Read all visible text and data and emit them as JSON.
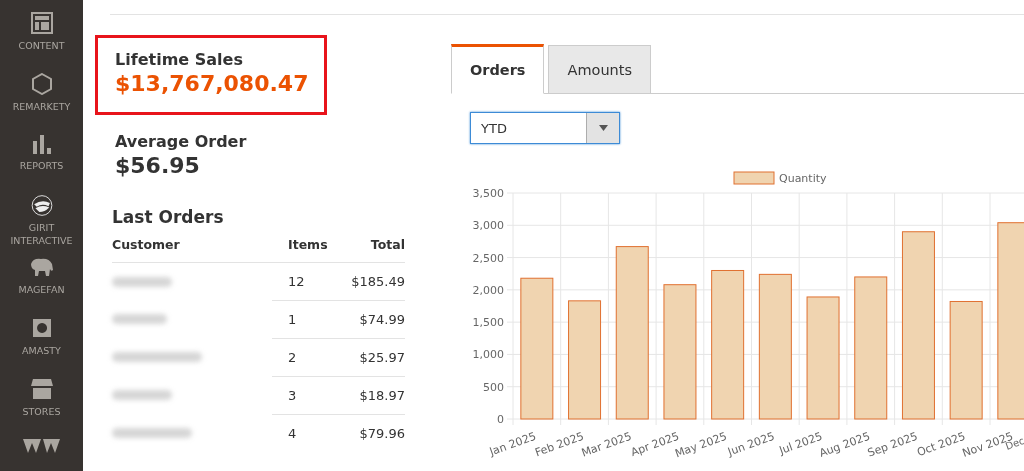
{
  "sidebar": {
    "items": [
      {
        "label": "CONTENT",
        "kind": "content"
      },
      {
        "label": "REMARKETY",
        "kind": "hexagon"
      },
      {
        "label": "REPORTS",
        "kind": "reports"
      },
      {
        "label": "GIRIT INTERACTIVE",
        "kind": "badger"
      },
      {
        "label": "MAGEFAN",
        "kind": "elephant"
      },
      {
        "label": "AMASTY",
        "kind": "amasty"
      },
      {
        "label": "STORES",
        "kind": "stores"
      },
      {
        "kind": "logo"
      }
    ]
  },
  "lifetime_sales": {
    "label": "Lifetime Sales",
    "value": "$13,767,080.47",
    "highlighted": true
  },
  "average_order": {
    "label": "Average Order",
    "value": "$56.95"
  },
  "last_orders": {
    "title": "Last Orders",
    "columns": [
      "Customer",
      "Items",
      "Total"
    ],
    "rows": [
      {
        "items": "12",
        "total": "$185.49"
      },
      {
        "items": "1",
        "total": "$74.99"
      },
      {
        "items": "2",
        "total": "$25.97"
      },
      {
        "items": "3",
        "total": "$18.97"
      },
      {
        "items": "4",
        "total": "$79.96"
      }
    ]
  },
  "tabs": [
    {
      "label": "Orders",
      "selected": true
    },
    {
      "label": "Amounts",
      "selected": false
    }
  ],
  "period_select": {
    "value": "YTD"
  },
  "chart_data": {
    "type": "bar",
    "categories": [
      "Jan 2025",
      "Feb 2025",
      "Mar 2025",
      "Apr 2025",
      "May 2025",
      "Jun 2025",
      "Jul 2025",
      "Aug 2025",
      "Sep 2025",
      "Oct 2025",
      "Nov 2025",
      "Dec"
    ],
    "series": [
      {
        "name": "Quantity",
        "color": "#f0d4b0",
        "values": [
          2180,
          1830,
          2670,
          2080,
          2300,
          2240,
          1890,
          2200,
          2900,
          1820,
          3040,
          null
        ]
      }
    ],
    "ylim": [
      0,
      3500
    ],
    "grid": true,
    "yticks": [
      {
        "value": 0,
        "label": "0"
      },
      {
        "value": 500,
        "label": "500"
      },
      {
        "value": 1000,
        "label": "1,000"
      },
      {
        "value": 1500,
        "label": "1,500"
      },
      {
        "value": 2000,
        "label": "2,000"
      },
      {
        "value": 2500,
        "label": "2,500"
      },
      {
        "value": 3000,
        "label": "3,000"
      },
      {
        "value": 3500,
        "label": "3,500"
      }
    ]
  }
}
